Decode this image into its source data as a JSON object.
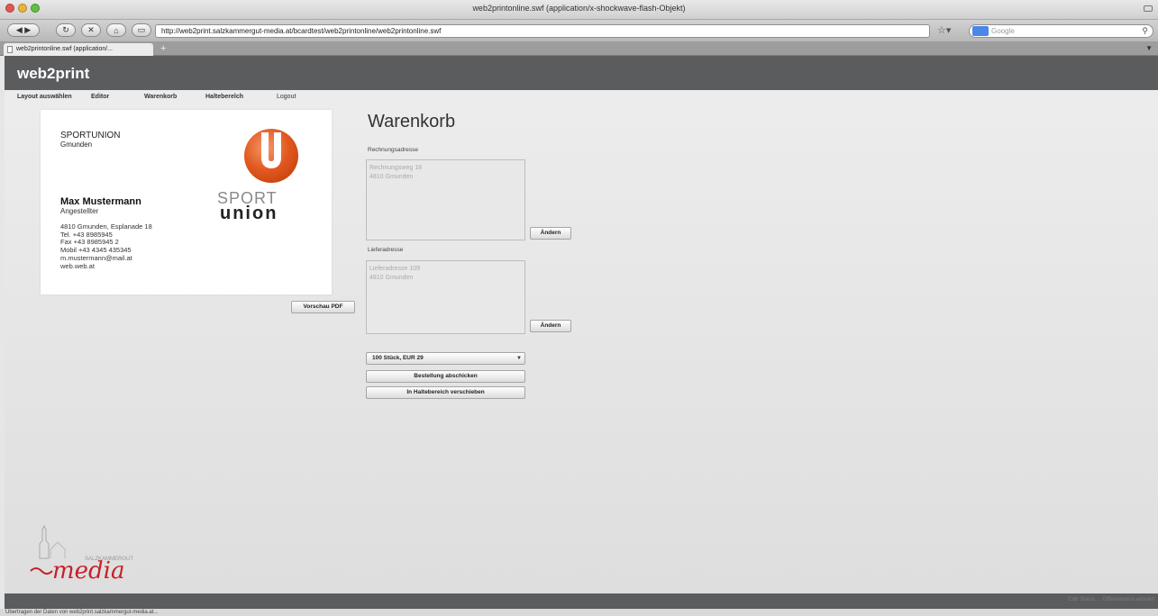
{
  "window": {
    "title": "web2printonline.swf (application/x-shockwave-flash-Objekt)"
  },
  "browser": {
    "url": "http://web2print.salzkammergut-media.at/bcardtest/web2printonline/web2printonline.swf",
    "search_placeholder": "Google",
    "tab_title": "web2printonline.swf (application/...",
    "new_tab": "+",
    "status_text": "Übertragen der Daten von web2print.salzkammergut-media.at..."
  },
  "app": {
    "brand": "web2print",
    "menu": [
      "Layout auswählen",
      "Editor",
      "Warenkorb",
      "Halteberelch",
      "Logout"
    ]
  },
  "card": {
    "org_line1": "SPORTUNION",
    "org_line2": "Gmunden",
    "name": "Max Mustermann",
    "job_title": "Angestellter",
    "contact": [
      "4810 Gmunden, Esplanade 18",
      "Tel. +43 8985945",
      "Fax +43 8985945 2",
      "Mobil +43 4345 435345",
      "m.mustermann@mail.at",
      "web.web.at"
    ],
    "logo_word1": "SPORT",
    "logo_word2": "union",
    "logo_color": "#e2581f"
  },
  "preview_button": "Vorschau PDF",
  "cart": {
    "title": "Warenkorb",
    "billing_label": "Rechnungsadresse",
    "billing_text": "Rechnungsweg 18\n4810 Gmunden",
    "billing_change": "Ändern",
    "delivery_label": "Lieferadresse",
    "delivery_text": "Lieferadresse 109\n4810 Gmunden",
    "delivery_change": "Ändern",
    "quantity_selected": "100 Stück, EUR 29",
    "order_button": "Bestellung abschicken",
    "hold_button": "In Haltebereich verschieben"
  },
  "footer": {
    "logo_text": "media",
    "logo_small": "SALZKAMMERGUT",
    "status_right": "Cdb Status ... Offlinemodus aktiviert"
  }
}
